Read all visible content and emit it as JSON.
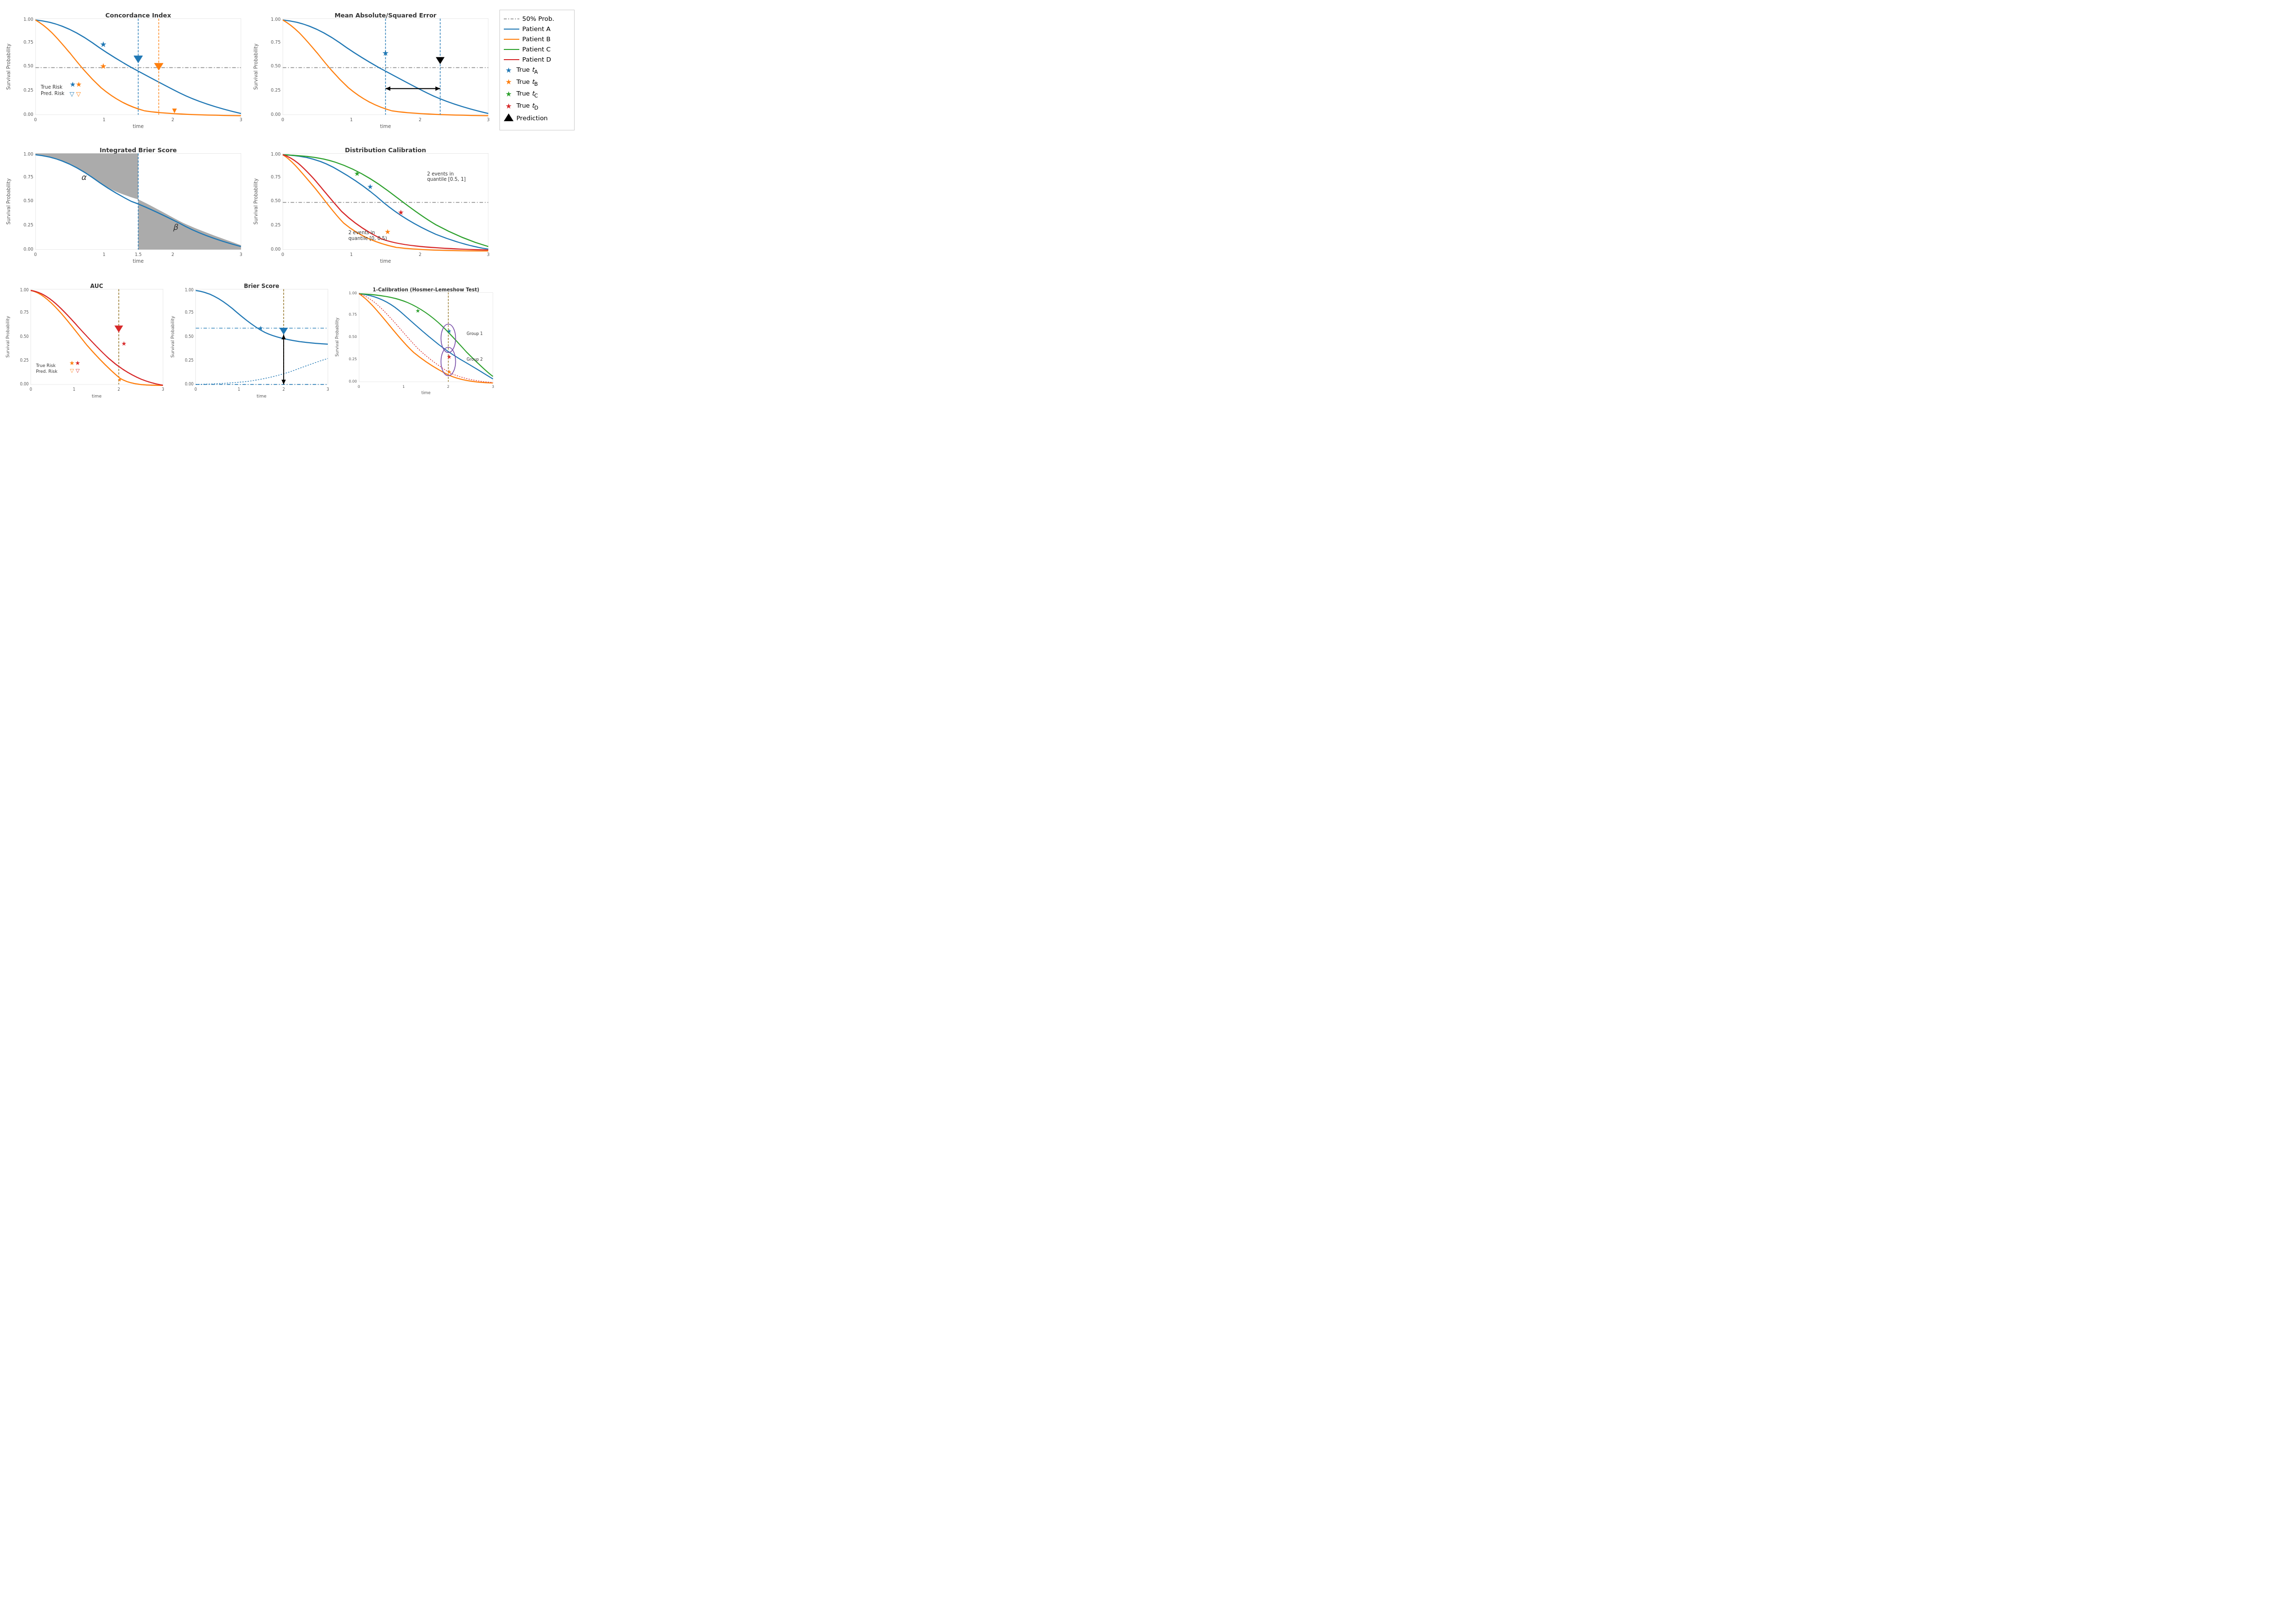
{
  "plots": {
    "concordance_index": {
      "title": "Concordance Index",
      "xlabel": "time",
      "ylabel": "Survival Probability"
    },
    "mae": {
      "title": "Mean Absolute/Squared Error",
      "xlabel": "time",
      "ylabel": "Survival Probability"
    },
    "ibs": {
      "title": "Integrated Brier Score",
      "xlabel": "time",
      "ylabel": "Survival Probability"
    },
    "dist_cal": {
      "title": "Distribution Calibration",
      "xlabel": "time",
      "ylabel": "Survival Probability"
    },
    "auc": {
      "title": "AUC",
      "xlabel": "time",
      "ylabel": "Survival Probability"
    },
    "brier": {
      "title": "Brier Score",
      "xlabel": "time",
      "ylabel": "Survival Probability"
    },
    "hosmer": {
      "title": "1-Calibration (Hosmer-Lemeshow Test)",
      "xlabel": "time",
      "ylabel": "Survival Probability"
    }
  },
  "legend": {
    "items": [
      {
        "label": "50% Prob.",
        "type": "dashdot",
        "color": "#888888"
      },
      {
        "label": "Patient A",
        "type": "line",
        "color": "#1f77b4"
      },
      {
        "label": "Patient B",
        "type": "line",
        "color": "#ff7f0e"
      },
      {
        "label": "Patient C",
        "type": "line",
        "color": "#2ca02c"
      },
      {
        "label": "Patient D",
        "type": "line",
        "color": "#d62728"
      },
      {
        "label": "True tA",
        "type": "star",
        "color": "#1f77b4"
      },
      {
        "label": "True tB",
        "type": "star",
        "color": "#ff7f0e"
      },
      {
        "label": "True tC",
        "type": "star",
        "color": "#2ca02c"
      },
      {
        "label": "True tD",
        "type": "star",
        "color": "#d62728"
      },
      {
        "label": "Prediction",
        "type": "triangle",
        "color": "#000000"
      }
    ]
  }
}
